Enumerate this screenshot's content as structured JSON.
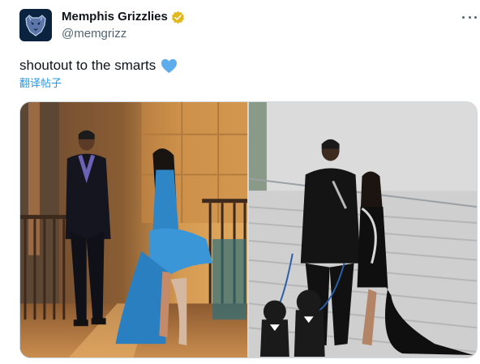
{
  "account": {
    "display_name": "Memphis Grizzlies",
    "handle": "@memgrizz",
    "verified_badge": "gold-verified-badge-icon",
    "avatar_icon": "grizzlies-bear-logo-icon"
  },
  "tweet": {
    "text": "shoutout to the smarts",
    "emoji": "blue-heart-icon",
    "translate_label": "翻译帖子"
  },
  "menu": {
    "icon": "more-options-icon"
  },
  "colors": {
    "text_primary": "#0f1419",
    "text_secondary": "#536471",
    "link": "#1d9bf0",
    "verified_gold": "#e2b719",
    "heart_blue": "#5dadec",
    "avatar_bg": "#0c2340"
  },
  "media": {
    "count": 2
  }
}
